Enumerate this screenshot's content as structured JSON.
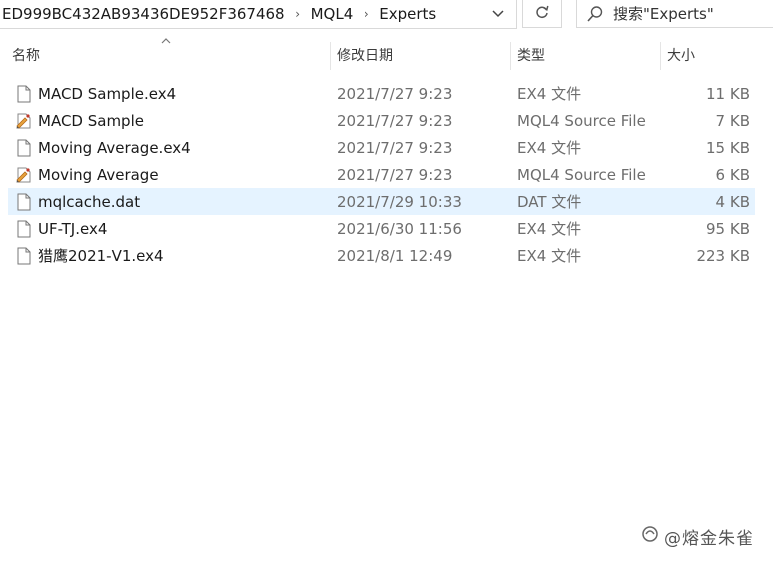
{
  "address_bar": {
    "crumbs": [
      "ED999BC432AB93436DE952F367468",
      "MQL4",
      "Experts"
    ],
    "separator": "›"
  },
  "search": {
    "placeholder": "搜索\"Experts\""
  },
  "columns": {
    "name": "名称",
    "date": "修改日期",
    "type": "类型",
    "size": "大小"
  },
  "files": [
    {
      "name": "MACD Sample.ex4",
      "date": "2021/7/27 9:23",
      "type": "EX4 文件",
      "size": "11 KB",
      "icon": "file-icon",
      "selected": false
    },
    {
      "name": "MACD Sample",
      "date": "2021/7/27 9:23",
      "type": "MQL4 Source File",
      "size": "7 KB",
      "icon": "mql4-source-icon",
      "selected": false
    },
    {
      "name": "Moving Average.ex4",
      "date": "2021/7/27 9:23",
      "type": "EX4 文件",
      "size": "15 KB",
      "icon": "file-icon",
      "selected": false
    },
    {
      "name": "Moving Average",
      "date": "2021/7/27 9:23",
      "type": "MQL4 Source File",
      "size": "6 KB",
      "icon": "mql4-source-icon",
      "selected": false
    },
    {
      "name": "mqlcache.dat",
      "date": "2021/7/29 10:33",
      "type": "DAT 文件",
      "size": "4 KB",
      "icon": "file-icon",
      "selected": true
    },
    {
      "name": "UF-TJ.ex4",
      "date": "2021/6/30 11:56",
      "type": "EX4 文件",
      "size": "95 KB",
      "icon": "file-icon",
      "selected": false
    },
    {
      "name": "猎鹰2021-V1.ex4",
      "date": "2021/8/1 12:49",
      "type": "EX4 文件",
      "size": "223 KB",
      "icon": "file-icon",
      "selected": false
    }
  ],
  "watermark": "@熔金朱雀",
  "colors": {
    "selected_row": "#e5f3ff",
    "muted_text": "#6d6d6d"
  }
}
